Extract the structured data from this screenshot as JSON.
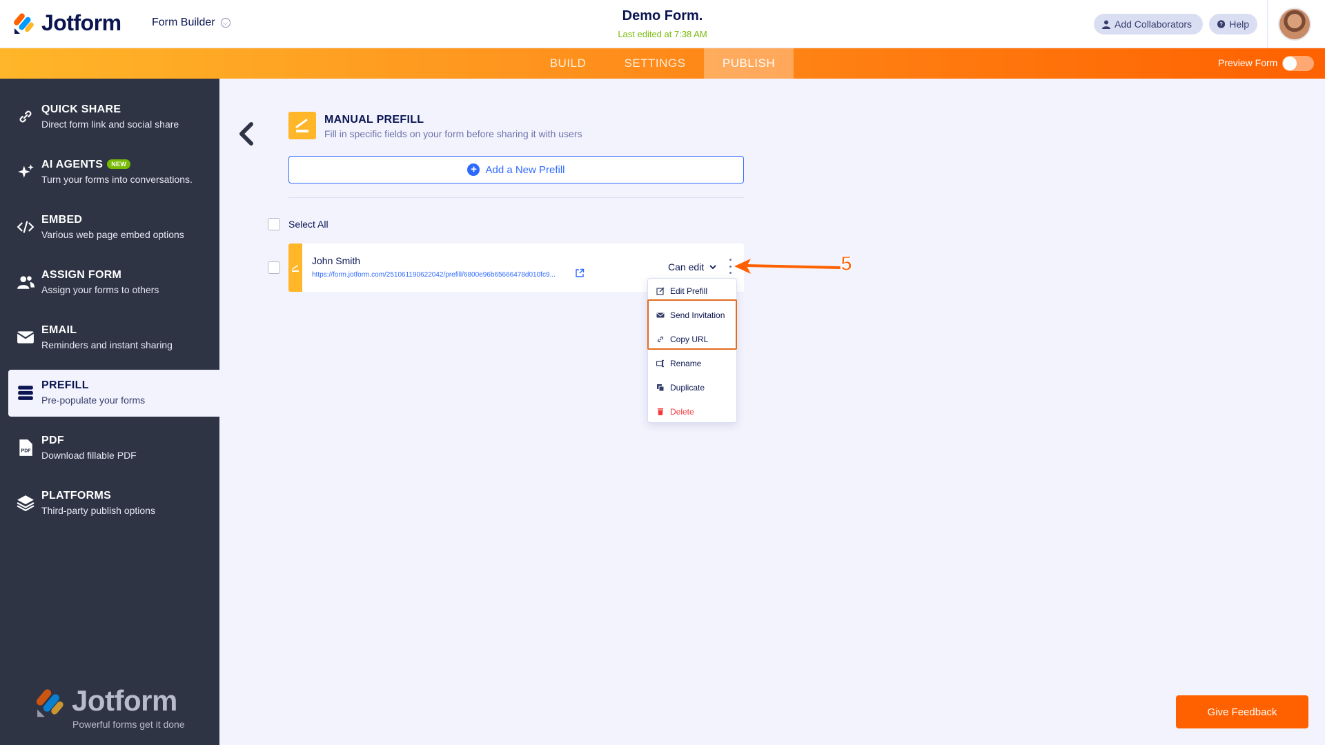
{
  "header": {
    "logo_text": "Jotform",
    "builder_label": "Form Builder",
    "form_title": "Demo Form.",
    "last_edited": "Last edited at 7:38 AM",
    "collaborators_label": "Add Collaborators",
    "help_label": "Help"
  },
  "nav": {
    "tabs": [
      {
        "label": "BUILD",
        "active": false
      },
      {
        "label": "SETTINGS",
        "active": false
      },
      {
        "label": "PUBLISH",
        "active": true
      }
    ],
    "preview_label": "Preview Form",
    "preview_on": false
  },
  "sidebar": {
    "items": [
      {
        "title": "QUICK SHARE",
        "desc": "Direct form link and social share",
        "icon": "link-icon"
      },
      {
        "title": "AI AGENTS",
        "badge": "NEW",
        "desc": "Turn your forms into conversations.",
        "icon": "sparkle-icon"
      },
      {
        "title": "EMBED",
        "desc": "Various web page embed options",
        "icon": "code-icon"
      },
      {
        "title": "ASSIGN FORM",
        "desc": "Assign your forms to others",
        "icon": "users-icon"
      },
      {
        "title": "EMAIL",
        "desc": "Reminders and instant sharing",
        "icon": "envelope-icon"
      },
      {
        "title": "PREFILL",
        "desc": "Pre-populate your forms",
        "icon": "database-icon",
        "active": true
      },
      {
        "title": "PDF",
        "desc": "Download fillable PDF",
        "icon": "pdf-icon"
      },
      {
        "title": "PLATFORMS",
        "desc": "Third-party publish options",
        "icon": "layers-icon"
      }
    ],
    "footer_logo": "Jotform",
    "footer_tagline": "Powerful forms get it done"
  },
  "main": {
    "section_title": "MANUAL PREFILL",
    "section_desc": "Fill in specific fields on your form before sharing it with users",
    "add_button": "Add a New Prefill",
    "select_all": "Select All",
    "rows": [
      {
        "name": "John Smith",
        "url": "https://form.jotform.com/251061190622042/prefill/6800e96b65666478d010fc9...",
        "permission": "Can edit"
      }
    ],
    "menu": [
      {
        "label": "Edit Prefill",
        "icon": "edit-icon"
      },
      {
        "label": "Send Invitation",
        "icon": "envelope-icon"
      },
      {
        "label": "Copy URL",
        "icon": "link-icon"
      },
      {
        "label": "Rename",
        "icon": "rename-icon"
      },
      {
        "label": "Duplicate",
        "icon": "duplicate-icon"
      },
      {
        "label": "Delete",
        "icon": "trash-icon",
        "danger": true
      }
    ]
  },
  "annotation": {
    "step": "5",
    "color": "#ff6100"
  },
  "feedback_label": "Give Feedback",
  "colors": {
    "accent": "#ff6100",
    "prefill": "#ffb629",
    "link": "#2e69ff",
    "sidebar": "#2f3445",
    "highlight": "#e36b1e"
  }
}
